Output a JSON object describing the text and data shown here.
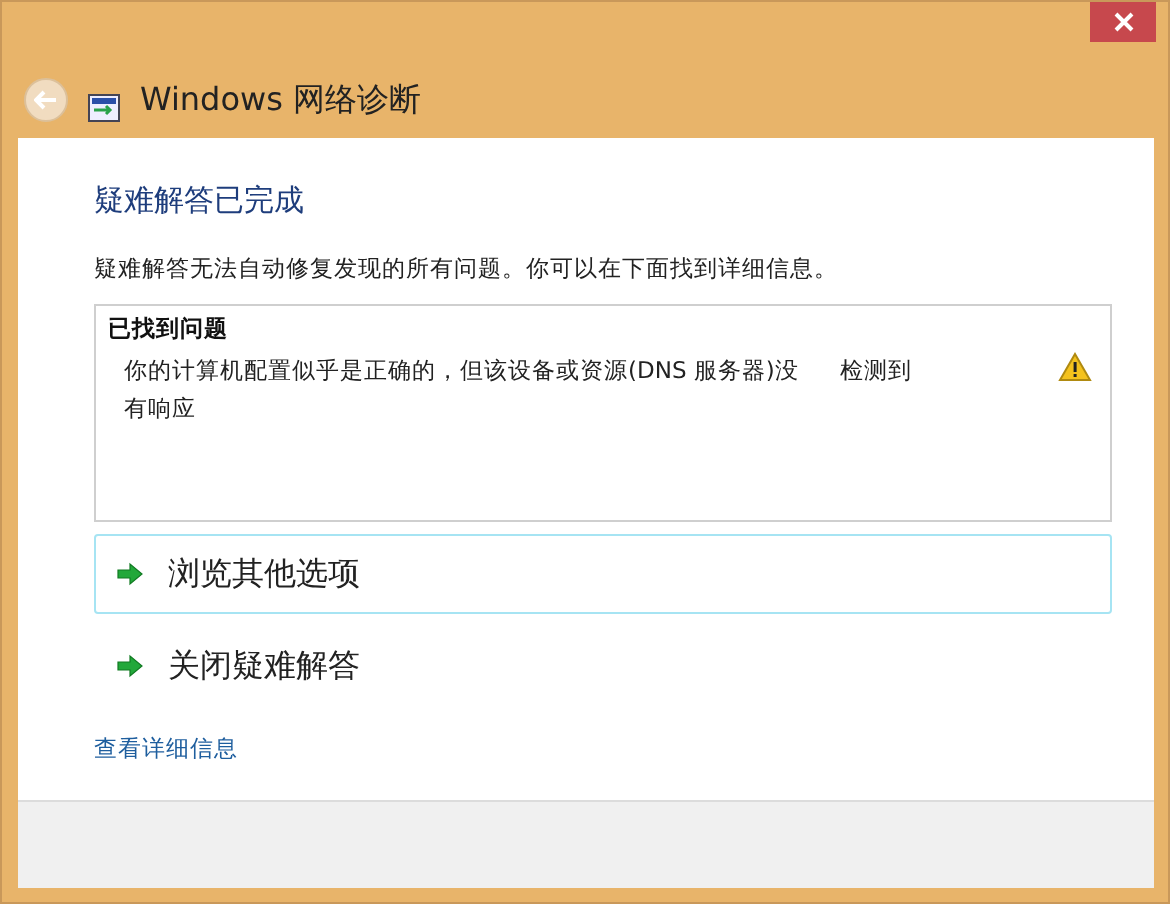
{
  "window": {
    "title": "Windows 网络诊断"
  },
  "heading": "疑难解答已完成",
  "description": "疑难解答无法自动修复发现的所有问题。你可以在下面找到详细信息。",
  "problems": {
    "title": "已找到问题",
    "items": [
      {
        "text": "你的计算机配置似乎是正确的，但该设备或资源(DNS 服务器)没有响应",
        "status": "检测到",
        "kind": "warning"
      }
    ]
  },
  "options": [
    {
      "label": "浏览其他选项",
      "selected": true
    },
    {
      "label": "关闭疑难解答",
      "selected": false
    }
  ],
  "details_link": "查看详细信息"
}
